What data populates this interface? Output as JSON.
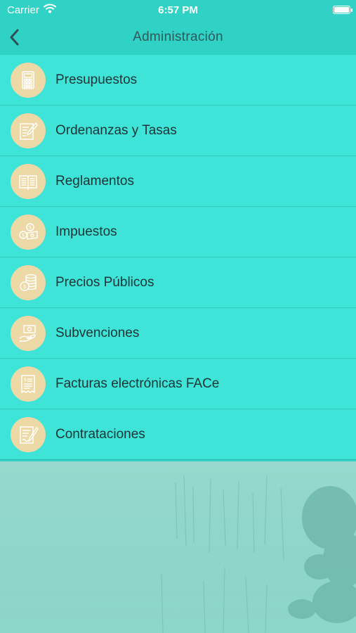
{
  "status_bar": {
    "carrier": "Carrier",
    "time": "6:57 PM"
  },
  "nav": {
    "title": "Administración"
  },
  "menu": [
    {
      "label": "Presupuestos",
      "icon": "calculator-icon"
    },
    {
      "label": "Ordenanzas y Tasas",
      "icon": "document-edit-icon"
    },
    {
      "label": "Reglamentos",
      "icon": "open-book-icon"
    },
    {
      "label": "Impuestos",
      "icon": "coins-bill-icon"
    },
    {
      "label": "Precios Públicos",
      "icon": "coin-stack-icon"
    },
    {
      "label": "Subvenciones",
      "icon": "hand-money-icon"
    },
    {
      "label": "Facturas electrónicas FACe",
      "icon": "invoice-icon"
    },
    {
      "label": "Contrataciones",
      "icon": "contract-pen-icon"
    }
  ],
  "colors": {
    "header": "#30d2c5",
    "list_background": "#3fe4d8",
    "icon_circle": "#ecd9a6",
    "icon_stroke": "#ffffff",
    "title_text": "#2f5a5a"
  }
}
